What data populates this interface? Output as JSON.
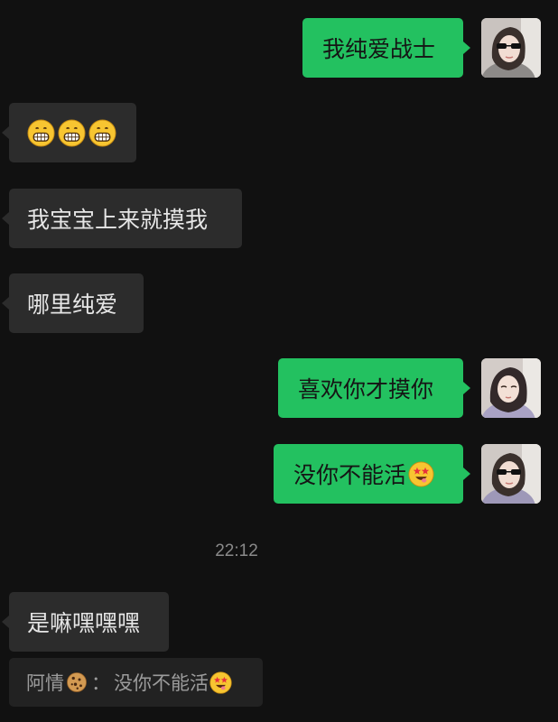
{
  "messages": [
    {
      "side": "right",
      "text": "我纯爱战士"
    },
    {
      "side": "left",
      "emoji": [
        "grinning-face-icon",
        "grinning-face-icon",
        "grinning-face-icon"
      ]
    },
    {
      "side": "left",
      "text": "我宝宝上来就摸我"
    },
    {
      "side": "left",
      "text": "哪里纯爱"
    },
    {
      "side": "right",
      "text": "喜欢你才摸你"
    },
    {
      "side": "right",
      "text": "没你不能活",
      "emoji": [
        "star-struck-face-icon"
      ]
    },
    {
      "side": "left",
      "text": "是嘛嘿嘿嘿"
    }
  ],
  "timestamp": "22:12",
  "quote": {
    "sender": "阿情",
    "sender_emoji": "cookie-icon",
    "separator": "：",
    "text": "没你不能活",
    "emoji": "star-struck-face-icon"
  },
  "colors": {
    "background": "#111111",
    "incoming_bubble": "#2c2c2c",
    "outgoing_bubble": "#23c160",
    "timestamp": "#8a8a8a",
    "quote_bg": "#222222"
  }
}
